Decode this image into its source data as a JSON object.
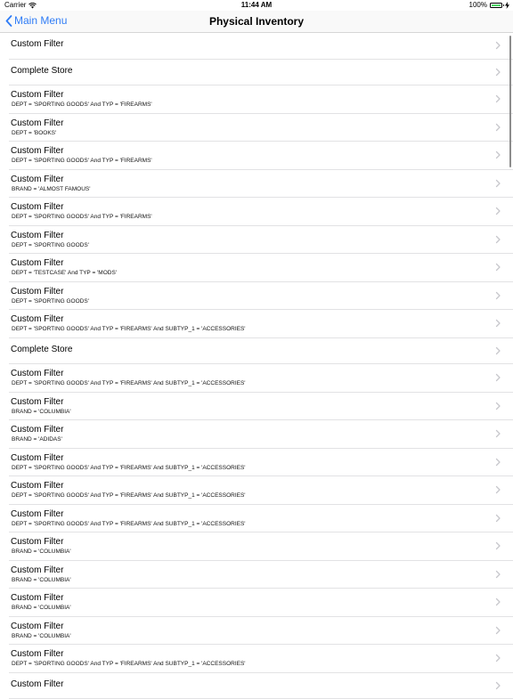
{
  "status": {
    "carrier": "Carrier",
    "time": "11:44 AM",
    "battery": "100%"
  },
  "nav": {
    "back_label": "Main Menu",
    "title": "Physical Inventory"
  },
  "rows": [
    {
      "title": "Custom Filter",
      "subtitle": ""
    },
    {
      "title": "Complete Store",
      "subtitle": ""
    },
    {
      "title": "Custom Filter",
      "subtitle": "DEPT = 'SPORTING GOODS' And TYP = 'FIREARMS'"
    },
    {
      "title": "Custom Filter",
      "subtitle": "DEPT = 'BOOKS'"
    },
    {
      "title": "Custom Filter",
      "subtitle": "DEPT = 'SPORTING GOODS' And TYP = 'FIREARMS'"
    },
    {
      "title": "Custom Filter",
      "subtitle": "BRAND = 'ALMOST FAMOUS'"
    },
    {
      "title": "Custom Filter",
      "subtitle": "DEPT = 'SPORTING GOODS' And TYP = 'FIREARMS'"
    },
    {
      "title": "Custom Filter",
      "subtitle": "DEPT = 'SPORTING GOODS'"
    },
    {
      "title": "Custom Filter",
      "subtitle": "DEPT = 'TESTCASE' And TYP = 'MODS'"
    },
    {
      "title": "Custom Filter",
      "subtitle": "DEPT = 'SPORTING GOODS'"
    },
    {
      "title": "Custom Filter",
      "subtitle": "DEPT = 'SPORTING GOODS' And TYP = 'FIREARMS' And SUBTYP_1 = 'ACCESSORIES'"
    },
    {
      "title": "Complete Store",
      "subtitle": ""
    },
    {
      "title": "Custom Filter",
      "subtitle": "DEPT = 'SPORTING GOODS' And TYP = 'FIREARMS' And SUBTYP_1 = 'ACCESSORIES'"
    },
    {
      "title": "Custom Filter",
      "subtitle": "BRAND = 'COLUMBIA'"
    },
    {
      "title": "Custom Filter",
      "subtitle": "BRAND = 'ADIDAS'"
    },
    {
      "title": "Custom Filter",
      "subtitle": "DEPT = 'SPORTING GOODS' And TYP = 'FIREARMS' And SUBTYP_1 = 'ACCESSORIES'"
    },
    {
      "title": "Custom Filter",
      "subtitle": "DEPT = 'SPORTING GOODS' And TYP = 'FIREARMS' And SUBTYP_1 = 'ACCESSORIES'"
    },
    {
      "title": "Custom Filter",
      "subtitle": "DEPT = 'SPORTING GOODS' And TYP = 'FIREARMS' And SUBTYP_1 = 'ACCESSORIES'"
    },
    {
      "title": "Custom Filter",
      "subtitle": "BRAND = 'COLUMBIA'"
    },
    {
      "title": "Custom Filter",
      "subtitle": "BRAND = 'COLUMBIA'"
    },
    {
      "title": "Custom Filter",
      "subtitle": "BRAND = 'COLUMBIA'"
    },
    {
      "title": "Custom Filter",
      "subtitle": "BRAND = 'COLUMBIA'"
    },
    {
      "title": "Custom Filter",
      "subtitle": "DEPT = 'SPORTING GOODS' And TYP = 'FIREARMS' And SUBTYP_1 = 'ACCESSORIES'"
    },
    {
      "title": "Custom Filter",
      "subtitle": ""
    }
  ],
  "colors": {
    "accent": "#2f7cf6",
    "chevron": "#c7c7cc",
    "separator": "#e2e2e4"
  }
}
